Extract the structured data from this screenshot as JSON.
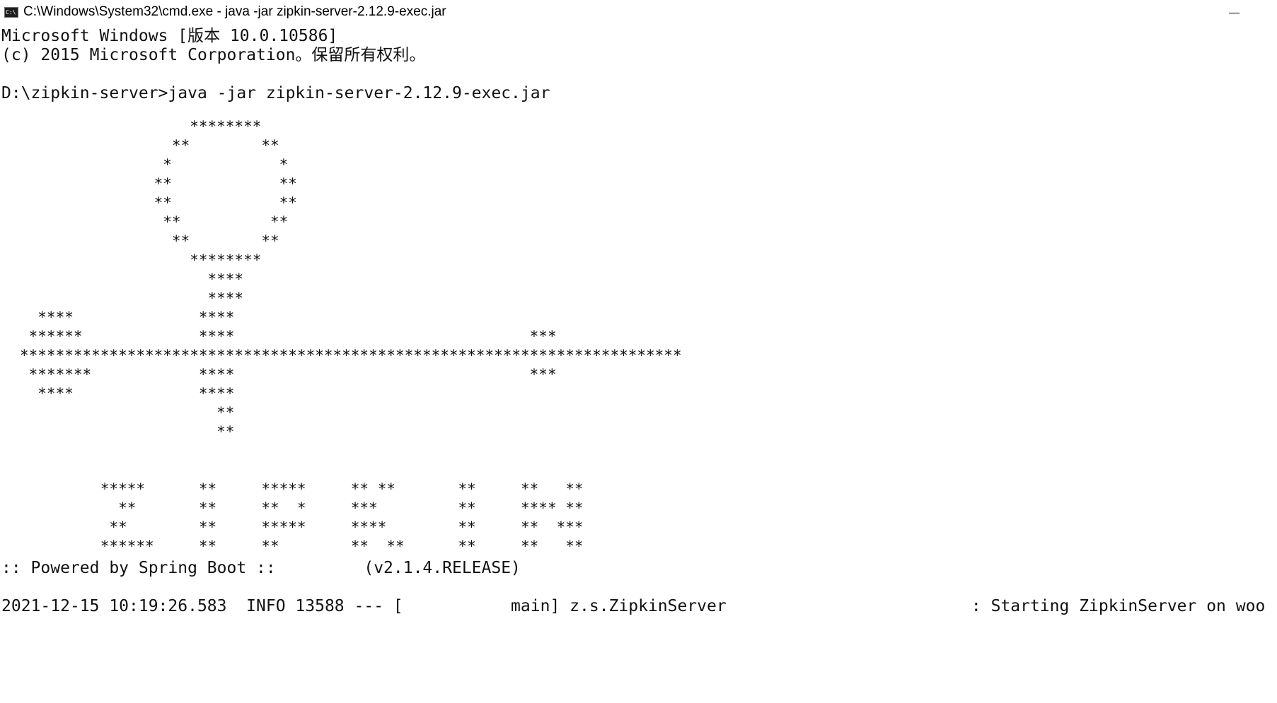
{
  "window": {
    "title": "C:\\Windows\\System32\\cmd.exe - java  -jar zipkin-server-2.12.9-exec.jar",
    "icon": "cmd-icon",
    "icon_text": "C:\\"
  },
  "console": {
    "banner_line1": "Microsoft Windows [版本 10.0.10586]",
    "banner_line2": "(c) 2015 Microsoft Corporation。保留所有权利。",
    "prompt": "D:\\zipkin-server>",
    "command": "java -jar zipkin-server-2.12.9-exec.jar",
    "art": [
      "                   ********",
      "                 **        **",
      "                *            *",
      "               **            **",
      "               **            **",
      "                **          **",
      "                 **        **",
      "                   ********",
      "                     ****",
      "                     ****",
      "  ****              ****",
      " ******             ****                                 ***",
      "**************************************************************************",
      " *******            ****                                 ***",
      "  ****              ****",
      "                      **",
      "                      **",
      "",
      "",
      "         *****      **     *****     ** **       **     **   **",
      "           **       **     **  *     ***         **     **** **",
      "          **        **     *****     ****        **     **  ***",
      "         ******     **     **        **  **      **     **   **"
    ],
    "powered_by": ":: Powered by Spring Boot ::         (v2.1.4.RELEASE)",
    "log_line": "2021-12-15 10:19:26.583  INFO 13588 --- [           main] z.s.ZipkinServer                         : Starting ZipkinServer on woo"
  }
}
